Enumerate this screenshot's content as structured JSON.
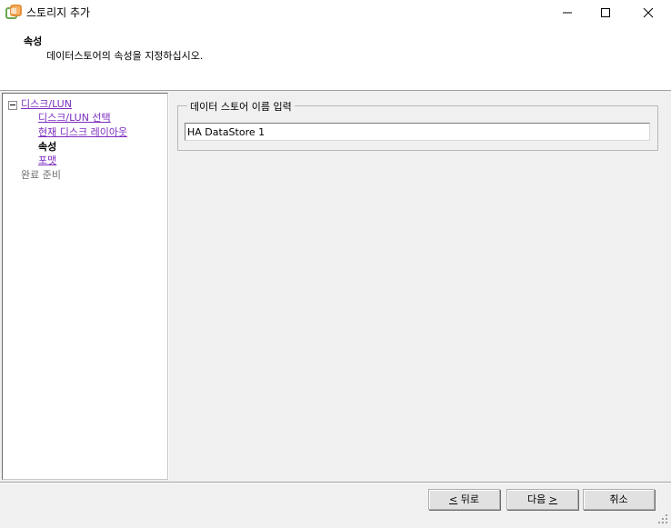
{
  "window": {
    "title": "스토리지 추가",
    "icons": {
      "app": "vsphere-app-icon",
      "minimize": "minimize-icon",
      "maximize": "maximize-icon",
      "close": "close-icon"
    }
  },
  "header": {
    "title": "속성",
    "subtitle": "데이터스토어의 속성을 지정하십시오."
  },
  "nav": {
    "items": [
      {
        "label": "디스크/LUN",
        "state": "link"
      },
      {
        "label": "디스크/LUN 선택",
        "state": "link"
      },
      {
        "label": "현재 디스크 레이아웃",
        "state": "link"
      },
      {
        "label": "속성",
        "state": "current"
      },
      {
        "label": "포맷",
        "state": "link"
      },
      {
        "label": "완료 준비",
        "state": "disabled"
      }
    ]
  },
  "form": {
    "group_label": "데이터 스토어 이름 입력",
    "datastore_name": "HA DataStore 1"
  },
  "buttons": {
    "back_accel": "<",
    "back_text": " 뒤로",
    "next_text": "다음 ",
    "next_accel": ">",
    "cancel": "취소"
  }
}
